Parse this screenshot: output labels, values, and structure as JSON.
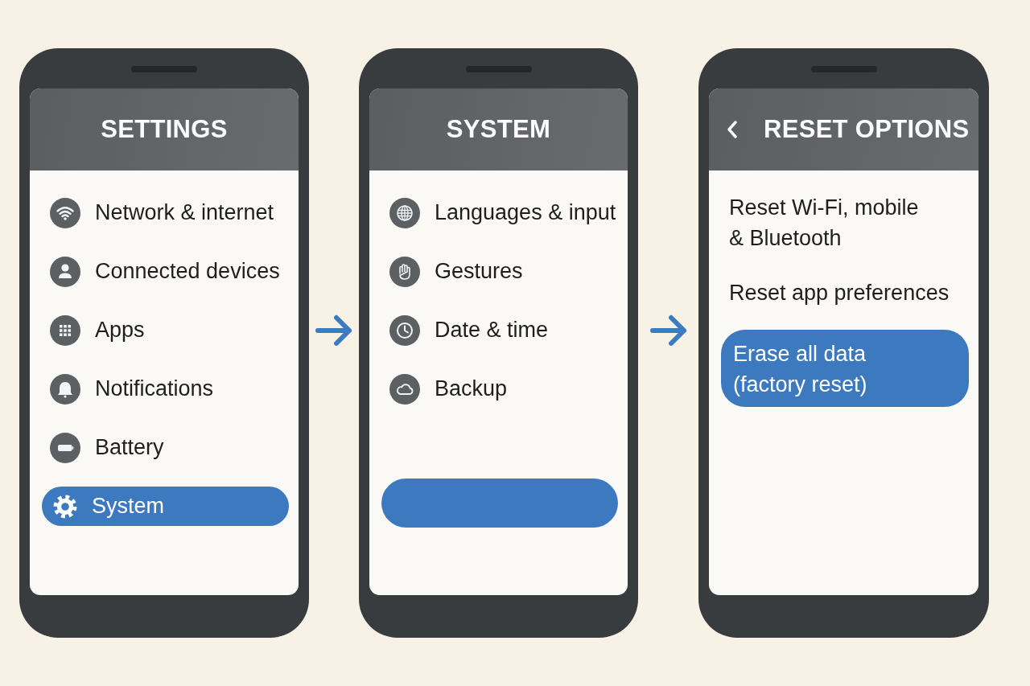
{
  "screens": [
    {
      "title": "SETTINGS",
      "items": [
        {
          "kind": "icon",
          "label": "Network & internet",
          "selected": false
        },
        {
          "kind": "icon",
          "label": "Connected devices",
          "selected": false
        },
        {
          "kind": "icon",
          "label": "Apps",
          "selected": false
        },
        {
          "kind": "icon",
          "label": "Notifications",
          "selected": false
        },
        {
          "kind": "icon",
          "label": "Battery",
          "selected": false
        },
        {
          "kind": "icon",
          "label": "System",
          "selected": true
        }
      ]
    },
    {
      "title": "SYSTEM",
      "items": [
        {
          "kind": "icon",
          "label": "Languages & input",
          "selected": false
        },
        {
          "kind": "icon",
          "label": "Gestures",
          "selected": false
        },
        {
          "kind": "icon",
          "label": "Date & time",
          "selected": false
        },
        {
          "kind": "icon",
          "label": "Backup",
          "selected": false
        }
      ],
      "highlight_bar": true
    },
    {
      "title": "RESET OPTIONS",
      "back_button": true,
      "items": [
        {
          "kind": "text",
          "label": "Reset Wi-Fi, mobile\n& Bluetooth",
          "selected": false
        },
        {
          "kind": "text",
          "label": "Reset app preferences",
          "selected": false
        },
        {
          "kind": "text",
          "label": "Erase all data\n(factory reset)",
          "selected": true
        }
      ]
    }
  ]
}
